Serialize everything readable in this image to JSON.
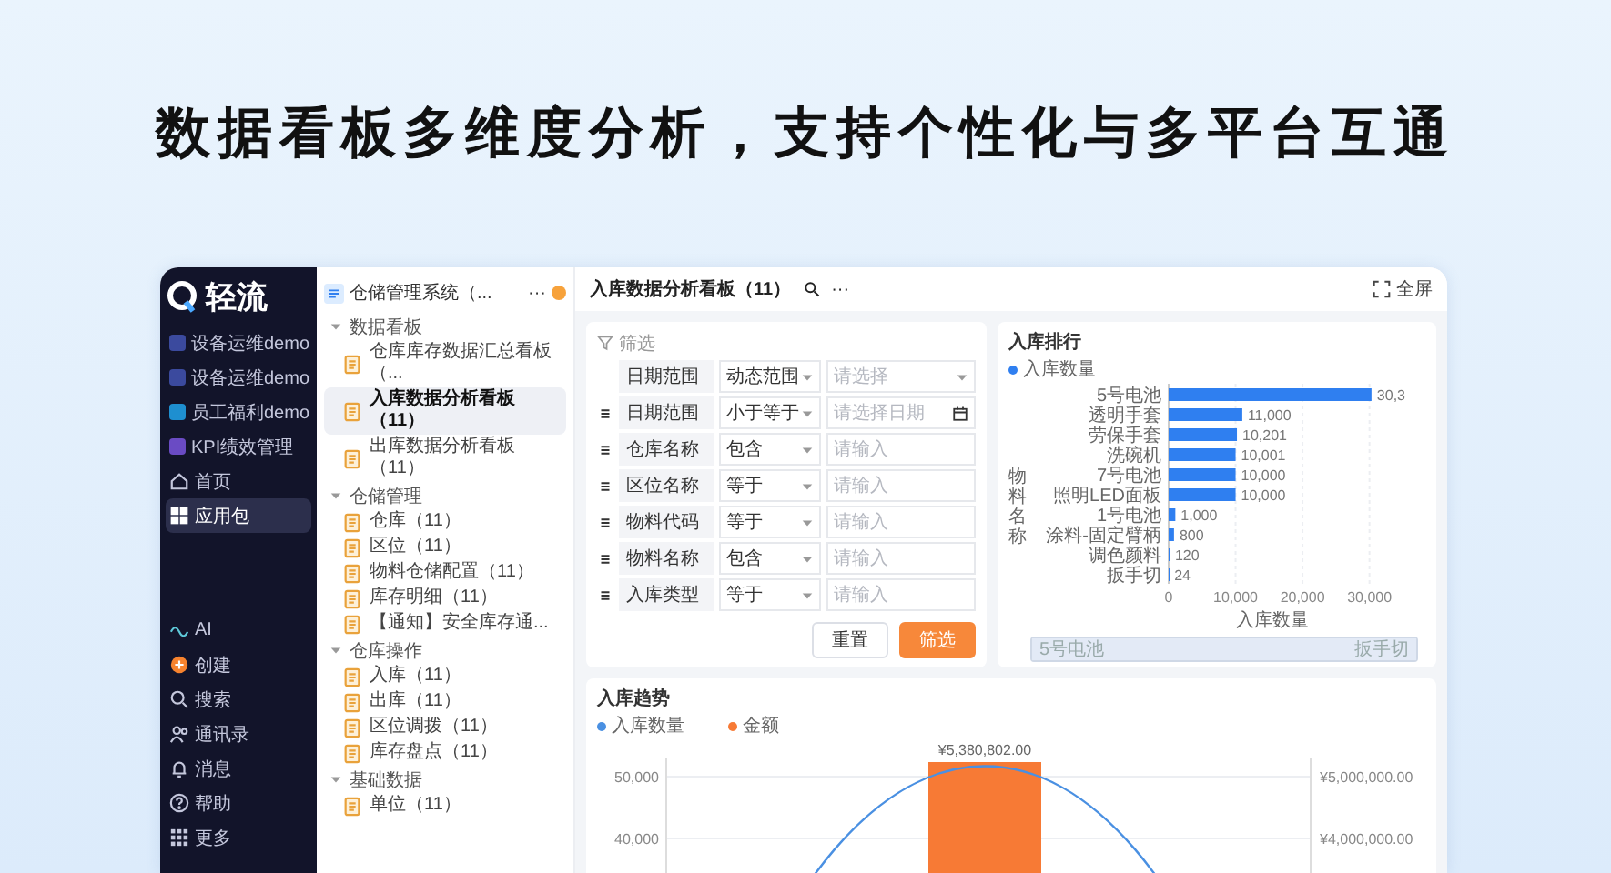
{
  "headline": "数据看板多维度分析，支持个性化与多平台互通",
  "sidebar": {
    "logo": "轻流",
    "apps": [
      {
        "label": "设备运维demo",
        "color": "#3b4a9e",
        "selected": false
      },
      {
        "label": "设备运维demo",
        "color": "#3b4a9e",
        "selected": false
      },
      {
        "label": "员工福利demo",
        "color": "#1e8fd0",
        "selected": false
      },
      {
        "label": "KPI绩效管理",
        "color": "#6a4bc4",
        "selected": false
      }
    ],
    "nav": [
      {
        "label": "首页",
        "selected": false
      },
      {
        "label": "应用包",
        "selected": true
      }
    ],
    "bottom": [
      "AI",
      "创建",
      "搜索",
      "通讯录",
      "消息",
      "帮助",
      "更多"
    ]
  },
  "tree": {
    "title": "仓储管理系统（...",
    "more": "···",
    "groups": [
      {
        "label": "数据看板",
        "expanded": true,
        "children": [
          {
            "label": "仓库库存数据汇总看板（...",
            "selected": false
          },
          {
            "label": "入库数据分析看板（11）",
            "selected": true
          },
          {
            "label": "出库数据分析看板（11）",
            "selected": false
          }
        ]
      },
      {
        "label": "仓储管理",
        "expanded": true,
        "children": [
          {
            "label": "仓库（11）",
            "selected": false
          },
          {
            "label": "区位（11）",
            "selected": false
          },
          {
            "label": "物料仓储配置（11）",
            "selected": false
          },
          {
            "label": "库存明细（11）",
            "selected": false
          },
          {
            "label": "【通知】安全库存通...",
            "selected": false
          }
        ]
      },
      {
        "label": "仓库操作",
        "expanded": true,
        "children": [
          {
            "label": "入库（11）",
            "selected": false
          },
          {
            "label": "出库（11）",
            "selected": false
          },
          {
            "label": "区位调拨（11）",
            "selected": false
          },
          {
            "label": "库存盘点（11）",
            "selected": false
          }
        ]
      },
      {
        "label": "基础数据",
        "expanded": true,
        "children": [
          {
            "label": "单位（11）",
            "selected": false
          }
        ]
      }
    ]
  },
  "dashboard": {
    "title": "入库数据分析看板（11）",
    "more": "···",
    "fullscreen": "全屏",
    "filter": {
      "label": "筛选",
      "rows": [
        {
          "field": "日期范围",
          "operator": "动态范围",
          "kind": "select",
          "placeholder": "请选择",
          "draggable": false
        },
        {
          "field": "日期范围",
          "operator": "小于等于",
          "kind": "date",
          "placeholder": "请选择日期",
          "draggable": true
        },
        {
          "field": "仓库名称",
          "operator": "包含",
          "kind": "input",
          "placeholder": "请输入",
          "draggable": true
        },
        {
          "field": "区位名称",
          "operator": "等于",
          "kind": "input",
          "placeholder": "请输入",
          "draggable": true
        },
        {
          "field": "物料代码",
          "operator": "等于",
          "kind": "input",
          "placeholder": "请输入",
          "draggable": true
        },
        {
          "field": "物料名称",
          "operator": "包含",
          "kind": "input",
          "placeholder": "请输入",
          "draggable": true
        },
        {
          "field": "入库类型",
          "operator": "等于",
          "kind": "input",
          "placeholder": "请输入",
          "draggable": true
        }
      ],
      "buttons": [
        {
          "label": "重置",
          "kind": "secondary"
        },
        {
          "label": "筛选",
          "kind": "primary"
        }
      ]
    },
    "ranking": {
      "title": "入库排行",
      "chart_data": {
        "type": "bar",
        "orientation": "horizontal",
        "xlabel": "入库数量",
        "ylabel": "物料名称",
        "categories": [
          "5号电池",
          "透明手套",
          "劳保手套",
          "洗碗机",
          "7号电池",
          "照明LED面板",
          "1号电池",
          "涂料-固定臂柄",
          "调色颜料",
          "扳手切"
        ],
        "series": [
          {
            "name": "入库数量",
            "color": "#2f7ff0",
            "values": [
              30300,
              11000,
              10201,
              10001,
              10000,
              10000,
              1000,
              800,
              120,
              24
            ]
          }
        ],
        "xlim": [
          0,
          31000
        ],
        "grid": true,
        "xticks": [
          0,
          {
            "value": 10000,
            "label": "10,000"
          },
          {
            "value": 20000,
            "label": "20,000"
          },
          {
            "value": 30000,
            "label": "30,000"
          }
        ],
        "value_labels": [
          "30,3",
          "11,000",
          "10,201",
          "10,001",
          "10,000",
          "10,000",
          "1,000",
          "800",
          "120",
          "24"
        ]
      },
      "zoom_slider": {
        "start_label": "5号电池",
        "end_label": "扳手切",
        "level": 1
      }
    },
    "trend": {
      "title": "入库趋势",
      "legend": [
        {
          "label": "入库数量",
          "color": "#4a90e2"
        },
        {
          "label": "金额",
          "color": "#f77a35"
        }
      ],
      "left_ticks": [
        "50,000",
        "40,000"
      ],
      "right_ticks": [
        "¥5,000,000.00",
        "¥4,000,000.00"
      ],
      "bar_label": "¥5,380,802.00"
    }
  }
}
